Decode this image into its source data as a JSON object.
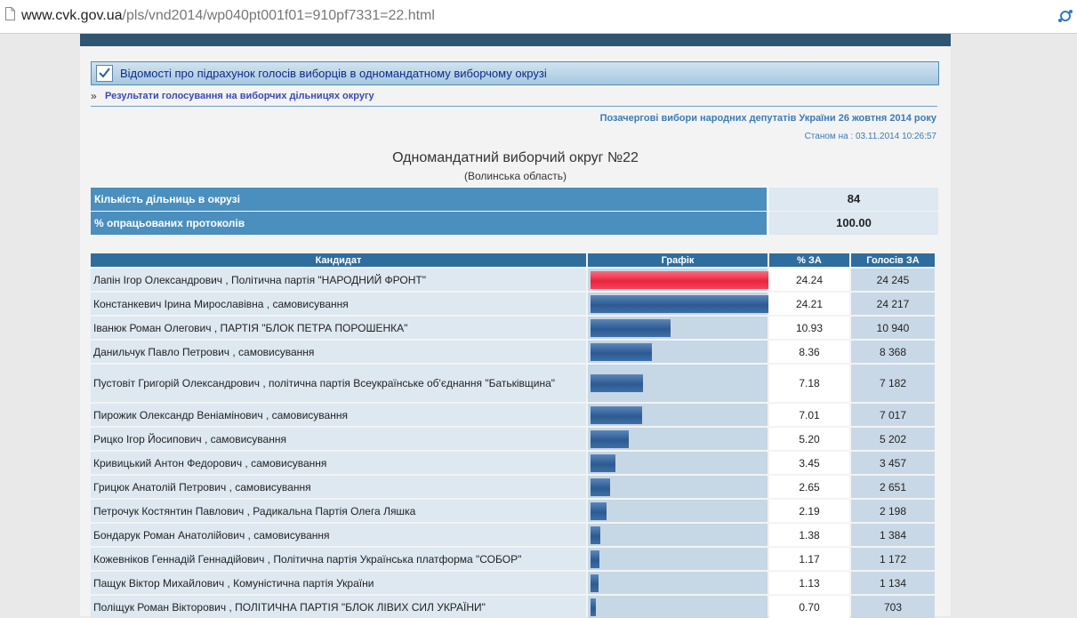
{
  "browser": {
    "url_host": "www.cvk.gov.ua",
    "url_path": "/pls/vnd2014/wp040pt001f01=910pf7331=22.html"
  },
  "section": {
    "title": "Відомості про підрахунок голосів виборців в одномандатному виборчому окрузі"
  },
  "breadcrumb": {
    "arrow": "»",
    "link": "Результати голосування на виборчих дільницях округу"
  },
  "election": {
    "title": "Позачергові вибори народних депутатів України 26 жовтня 2014 року",
    "status": "Станом на : 03.11.2014 10:26:57"
  },
  "district": {
    "title": "Одномандатний виборчий округ №22",
    "region": "(Волинська область)"
  },
  "stats": [
    {
      "label": "Кількість дільниць в окрузі",
      "value": "84"
    },
    {
      "label": "% опрацьованих протоколів",
      "value": "100.00"
    }
  ],
  "table": {
    "headers": {
      "candidate": "Кандидат",
      "graph": "Графік",
      "percent": "% ЗА",
      "votes": "Голосів ЗА"
    },
    "rows": [
      {
        "candidate": "Лапін Ігор Олександрович , Політична партія \"НАРОДНИЙ ФРОНТ\"",
        "percent": "24.24",
        "votes": "24 245",
        "share": 24.24
      },
      {
        "candidate": "Констанкевич Ірина Мирославівна , самовисування",
        "percent": "24.21",
        "votes": "24 217",
        "share": 24.21
      },
      {
        "candidate": "Іванюк Роман Олегович , ПАРТІЯ \"БЛОК ПЕТРА ПОРОШЕНКА\"",
        "percent": "10.93",
        "votes": "10 940",
        "share": 10.93
      },
      {
        "candidate": "Данильчук Павло Петрович , самовисування",
        "percent": "8.36",
        "votes": "8 368",
        "share": 8.36
      },
      {
        "candidate": "Пустовіт Григорій Олександрович , політична партія Всеукраїнське об'єднання \"Батьківщина\"",
        "percent": "7.18",
        "votes": "7 182",
        "share": 7.18
      },
      {
        "candidate": "Пирожик Олександр Веніамінович , самовисування",
        "percent": "7.01",
        "votes": "7 017",
        "share": 7.01
      },
      {
        "candidate": "Рицко Ігор Йосипович , самовисування",
        "percent": "5.20",
        "votes": "5 202",
        "share": 5.2
      },
      {
        "candidate": "Кривицький Антон Федорович , самовисування",
        "percent": "3.45",
        "votes": "3 457",
        "share": 3.45
      },
      {
        "candidate": "Грицюк Анатолій Петрович , самовисування",
        "percent": "2.65",
        "votes": "2 651",
        "share": 2.65
      },
      {
        "candidate": "Петрочук Костянтин Павлович , Радикальна Партія Олега Ляшка",
        "percent": "2.19",
        "votes": "2 198",
        "share": 2.19
      },
      {
        "candidate": "Бондарук Роман Анатолійович , самовисування",
        "percent": "1.38",
        "votes": "1 384",
        "share": 1.38
      },
      {
        "candidate": "Кожевніков Геннадій Геннадійович , Політична партія Українська платформа \"СОБОР\"",
        "percent": "1.17",
        "votes": "1 172",
        "share": 1.17
      },
      {
        "candidate": "Пащук Віктор Михайлович , Комуністична партія України",
        "percent": "1.13",
        "votes": "1 134",
        "share": 1.13
      },
      {
        "candidate": "Поліщук Роман Вікторович , ПОЛІТИЧНА ПАРТІЯ \"БЛОК ЛІВИХ СИЛ УКРАЇНИ\"",
        "percent": "0.70",
        "votes": "703",
        "share": 0.7
      }
    ]
  },
  "colors": {
    "header_bar": "#2f6d9e",
    "winner_bar": "#e8253e",
    "bar": "#2c5a93",
    "stat_label_bg": "#4a8fbd"
  }
}
